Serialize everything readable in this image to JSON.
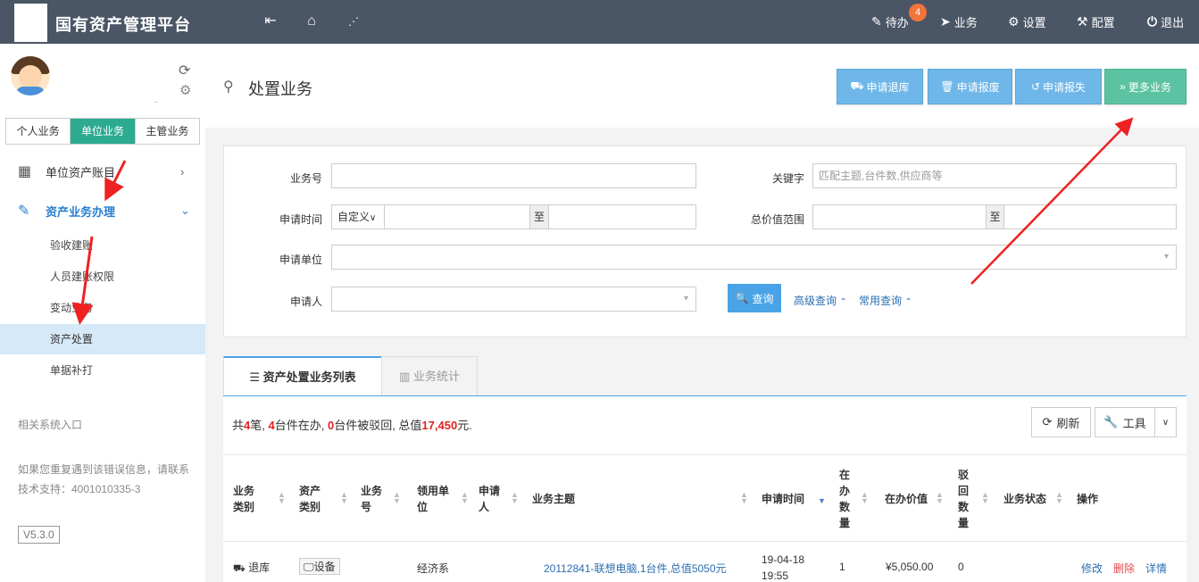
{
  "topbar": {
    "app_title": "国有资产管理平台",
    "badge_count": "4",
    "menus": [
      {
        "label": "待办",
        "icon": "edit-icon"
      },
      {
        "label": "业务",
        "icon": "send-icon"
      },
      {
        "label": "设置",
        "icon": "gear-icon"
      },
      {
        "label": "配置",
        "icon": "wrench-icon"
      },
      {
        "label": "退出",
        "icon": "power-icon"
      }
    ]
  },
  "sidebar": {
    "tabs": [
      "个人业务",
      "单位业务",
      "主管业务"
    ],
    "active_tab": "单位业务",
    "nav": [
      {
        "label": "单位资产账目"
      },
      {
        "label": "资产业务办理"
      }
    ],
    "subnav": [
      "验收建账",
      "人员建账权限",
      "变动业务",
      "资产处置",
      "单据补打"
    ],
    "active_subnav": "资产处置",
    "section_title": "相关系统入口",
    "help_text": "如果您重复遇到该错误信息，请联系技术支持：4001010335-3",
    "version": "V5.3.0"
  },
  "header": {
    "title": "处置业务",
    "buttons": [
      {
        "label": "申请退库"
      },
      {
        "label": "申请报废"
      },
      {
        "label": "申请报失"
      },
      {
        "label": "更多业务"
      }
    ]
  },
  "search": {
    "business_no_label": "业务号",
    "keyword_label": "关键字",
    "keyword_placeholder": "匹配主题,台件数,供应商等",
    "apply_time_label": "申请时间",
    "apply_time_mode": "自定义",
    "to": "至",
    "total_value_label": "总价值范围",
    "apply_unit_label": "申请单位",
    "applicant_label": "申请人",
    "query_button": "查询",
    "advanced_query": "高级查询",
    "common_query": "常用查询"
  },
  "list": {
    "tabs": [
      "资产处置业务列表",
      "业务统计"
    ],
    "summary": {
      "prefix": "共",
      "total_count": "4",
      "t1": "笔, ",
      "in_progress": "4",
      "t2": "台件在办, ",
      "rejected": "0",
      "t3": "台件被驳回, 总值",
      "total_value": "17,450",
      "t4": "元."
    },
    "refresh_button": "刷新",
    "tools_button": "工具",
    "columns": {
      "biz_type": "业务类别",
      "asset_type": "资产类别",
      "biz_no": "业务号",
      "unit": "领用单位",
      "applicant": "申请人",
      "subject": "业务主题",
      "apply_time": "申请时间",
      "in_progress_qty": "在办数量",
      "in_progress_value": "在办价值",
      "rejected_qty": "驳回数量",
      "status": "业务状态",
      "actions": "操作"
    },
    "rows": [
      {
        "biz_type": "退库",
        "asset_type": "设备",
        "biz_no": "",
        "unit": "经济系",
        "applicant": "",
        "subject": "20112841-联想电脑,1台件,总值5050元",
        "apply_time": "19-04-18 19:55",
        "in_progress_qty": "1",
        "in_progress_value": "¥5,050.00",
        "rejected_qty": "0",
        "status": "",
        "actions": [
          "修改",
          "删除",
          "详情"
        ]
      }
    ]
  }
}
